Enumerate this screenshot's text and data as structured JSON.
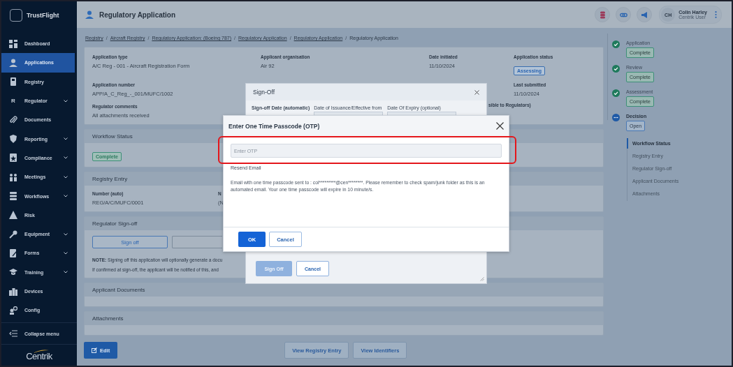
{
  "sidebar": {
    "brand": "TrustFlight",
    "items": [
      {
        "label": "Dashboard",
        "selected": false,
        "expandable": false
      },
      {
        "label": "Applications",
        "selected": true,
        "expandable": false
      },
      {
        "label": "Registry",
        "selected": false,
        "expandable": false
      },
      {
        "label": "Regulator",
        "glyph": "R",
        "selected": false,
        "expandable": true
      },
      {
        "label": "Documents",
        "selected": false,
        "expandable": false
      },
      {
        "label": "Reporting",
        "selected": false,
        "expandable": true
      },
      {
        "label": "Compliance",
        "selected": false,
        "expandable": true
      },
      {
        "label": "Meetings",
        "selected": false,
        "expandable": true
      },
      {
        "label": "Workflows",
        "selected": false,
        "expandable": true
      },
      {
        "label": "Risk",
        "selected": false,
        "expandable": false
      },
      {
        "label": "Equipment",
        "selected": false,
        "expandable": true
      },
      {
        "label": "Forms",
        "selected": false,
        "expandable": true
      },
      {
        "label": "Training",
        "selected": false,
        "expandable": true
      },
      {
        "label": "Devices",
        "selected": false,
        "expandable": false
      },
      {
        "label": "Config",
        "selected": false,
        "expandable": false
      }
    ],
    "collapse": "Collapse menu",
    "footer_logo": "Centrik"
  },
  "header": {
    "title": "Regulatory Application",
    "user": {
      "initials": "CH",
      "name": "Colin Harley",
      "role": "Centrik User"
    }
  },
  "breadcrumb_separator": "/",
  "breadcrumb": [
    {
      "label": "Registry",
      "link": true
    },
    {
      "label": "Aircraft Registry",
      "link": true
    },
    {
      "label": "Regulatory Application: (Boeing 787)",
      "link": true
    },
    {
      "label": "Regulatory Application",
      "link": true
    },
    {
      "label": "Regulatory Application",
      "link": true
    },
    {
      "label": "Regulatory Application",
      "link": false
    }
  ],
  "application": {
    "application_type": {
      "label": "Application type",
      "value": "A/C Reg - 001 - Aircraft Registration Form"
    },
    "applicant_organisation": {
      "label": "Applicant organisation",
      "value": "Air 92"
    },
    "date_initiated": {
      "label": "Date initiated",
      "value": "11/10/2024"
    },
    "application_status": {
      "label": "Application status",
      "value": "Assessing"
    },
    "application_number": {
      "label": "Application number",
      "value": "APP/A_C_Reg_-_001/MUFC/1002"
    },
    "last_submitted": {
      "label": "Last submitted",
      "value": "11/10/2024"
    },
    "regulator_comments": {
      "label": "Regulator comments",
      "value": "All attachments received"
    },
    "column_3_label_fragment": "sible to Regulators)"
  },
  "workflow_status": {
    "title": "Workflow Status",
    "status": "Complete"
  },
  "registry_entry": {
    "title": "Registry Entry",
    "number": {
      "label": "Number (auto)",
      "value": "REG/A/C/MUFC/0001"
    },
    "column_2": {
      "label": "N",
      "value": "(N"
    }
  },
  "regulator_signoff": {
    "title": "Regulator Sign-off",
    "button": "Sign off",
    "note": "**NOTE:** Signing off this application will optionally generate a docu",
    "note_2": "If confirmed at sign-off, the applicant will be notified of this, and"
  },
  "applicant_documents": {
    "title": "Applicant Documents"
  },
  "attachments": {
    "title": "Attachments"
  },
  "footer_buttons": {
    "edit": "Edit",
    "view_registry_entry": "View Registry Entry",
    "view_identifiers": "View Identifiers"
  },
  "workflow_steps": [
    {
      "label": "Application",
      "status": "Complete",
      "done": true
    },
    {
      "label": "Review",
      "status": "Complete",
      "done": true
    },
    {
      "label": "Assessment",
      "status": "Complete",
      "done": true
    },
    {
      "label": "Decision",
      "status": "Open",
      "done": false
    }
  ],
  "section_nav": [
    {
      "label": "Workflow Status",
      "selected": true
    },
    {
      "label": "Registry Entry",
      "selected": false
    },
    {
      "label": "Regulator Sign-off",
      "selected": false
    },
    {
      "label": "Applicant Documents",
      "selected": false
    },
    {
      "label": "Attachments",
      "selected": false
    }
  ],
  "signoff_dialog": {
    "title": "Sign-Off",
    "fields": [
      "Sign-off Date (automatic)",
      "Date of Issuance/Effective from",
      "Date Of Expiry (optional)"
    ],
    "submit": {
      "label": "Sign Off",
      "disabled": true
    },
    "cancel": "Cancel"
  },
  "otp_dialog": {
    "title": "Enter One Time Passcode (OTP)",
    "placeholder": "Enter OTP",
    "resend": "Resend Email",
    "message": "Email with one time passcode sent to : col*********@cen********. Please remember to check spam/junk folder as this is an automated email. Your one time passcode will expire in 10 minute/s.",
    "ok": "OK",
    "cancel": "Cancel",
    "highlighted": true
  }
}
